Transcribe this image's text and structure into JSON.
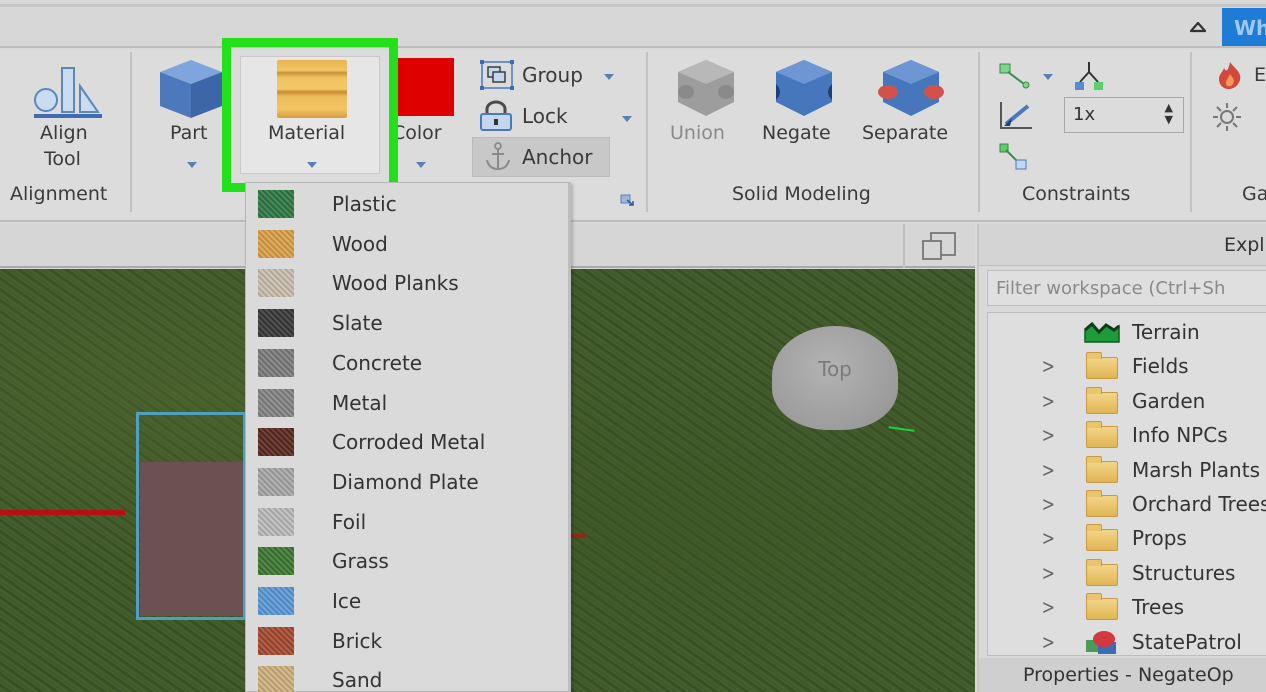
{
  "topbar": {
    "collapse_icon": "chevron-up-icon",
    "user_tab_label": "Wh"
  },
  "ribbon": {
    "alignment": {
      "group_label": "Alignment",
      "align_tool_line1": "Align",
      "align_tool_line2": "Tool"
    },
    "part": {
      "part_label": "Part",
      "material_label": "Material",
      "color_label": "Color",
      "color_value": "#de0000",
      "group_label": "Group",
      "lock_label": "Lock",
      "anchor_label": "Anchor"
    },
    "solid_modeling": {
      "group_label": "Solid Modeling",
      "union_label": "Union",
      "negate_label": "Negate",
      "separate_label": "Separate"
    },
    "constraints": {
      "group_label": "Constraints",
      "scale_value": "1x"
    },
    "gameplay": {
      "group_label_partial": "Ga",
      "effects_label_partial": "E"
    }
  },
  "material_menu": {
    "items": [
      {
        "label": "Plastic",
        "swatch": "#2f7a45"
      },
      {
        "label": "Wood",
        "swatch": "#dca24a"
      },
      {
        "label": "Wood Planks",
        "swatch": "#c9bfae"
      },
      {
        "label": "Slate",
        "swatch": "#3a3a3a"
      },
      {
        "label": "Concrete",
        "swatch": "#7d7d7d"
      },
      {
        "label": "Metal",
        "swatch": "#858585"
      },
      {
        "label": "Corroded Metal",
        "swatch": "#5a2a22"
      },
      {
        "label": "Diamond Plate",
        "swatch": "#a8a8a8"
      },
      {
        "label": "Foil",
        "swatch": "#bcbcbc"
      },
      {
        "label": "Grass",
        "swatch": "#3e7a32"
      },
      {
        "label": "Ice",
        "swatch": "#5a9ad8"
      },
      {
        "label": "Brick",
        "swatch": "#a64a30"
      },
      {
        "label": "Sand",
        "swatch": "#cfb280"
      }
    ]
  },
  "viewport": {
    "view_cube_label": "Top"
  },
  "explorer": {
    "title_partial": "Expl",
    "filter_placeholder": "Filter workspace (Ctrl+Sh",
    "items": [
      {
        "label": "Terrain",
        "icon": "terrain-icon",
        "expandable": false
      },
      {
        "label": "Fields",
        "icon": "folder-icon",
        "expandable": true
      },
      {
        "label": "Garden",
        "icon": "folder-icon",
        "expandable": true
      },
      {
        "label": "Info NPCs",
        "icon": "folder-icon",
        "expandable": true
      },
      {
        "label": "Marsh Plants",
        "icon": "folder-icon",
        "expandable": true
      },
      {
        "label": "Orchard Trees",
        "icon": "folder-icon",
        "expandable": true
      },
      {
        "label": "Props",
        "icon": "folder-icon",
        "expandable": true
      },
      {
        "label": "Structures",
        "icon": "folder-icon",
        "expandable": true
      },
      {
        "label": "Trees",
        "icon": "folder-icon",
        "expandable": true
      },
      {
        "label": "StatePatrol",
        "icon": "model-icon",
        "expandable": true
      }
    ],
    "properties_label": "Properties - NegateOp"
  }
}
